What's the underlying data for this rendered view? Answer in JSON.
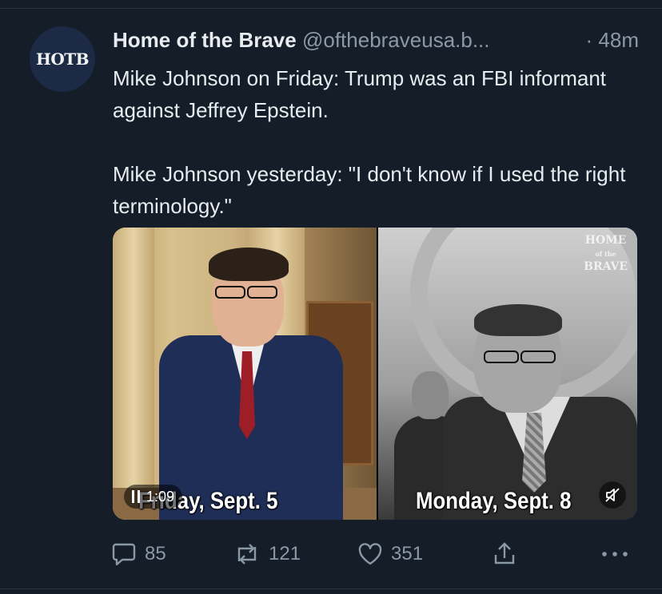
{
  "account": {
    "avatar_text": "HOTB",
    "display_name": "Home of the Brave",
    "handle": "@ofthebraveusa.b...",
    "time": "· 48m"
  },
  "tweet": {
    "line1": "Mike Johnson on Friday: Trump was an FBI informant against Jeffrey Epstein.",
    "line2": "Mike Johnson yesterday: \"I don't know if I used the right terminology.\""
  },
  "media": {
    "caption_left": "Friday, Sept. 5",
    "caption_right": "Monday, Sept. 8",
    "watermark": "HOME of the BRAVE",
    "video_time": "1:09"
  },
  "actions": {
    "replies": "85",
    "reposts": "121",
    "likes": "351"
  },
  "colors": {
    "background": "#151d28",
    "text": "#e7ecf0",
    "muted": "#8b98a5",
    "avatar_bg": "#1c2a46"
  },
  "icons": [
    "reply-icon",
    "repost-icon",
    "like-icon",
    "share-icon",
    "more-icon",
    "pause-icon",
    "mute-icon"
  ]
}
